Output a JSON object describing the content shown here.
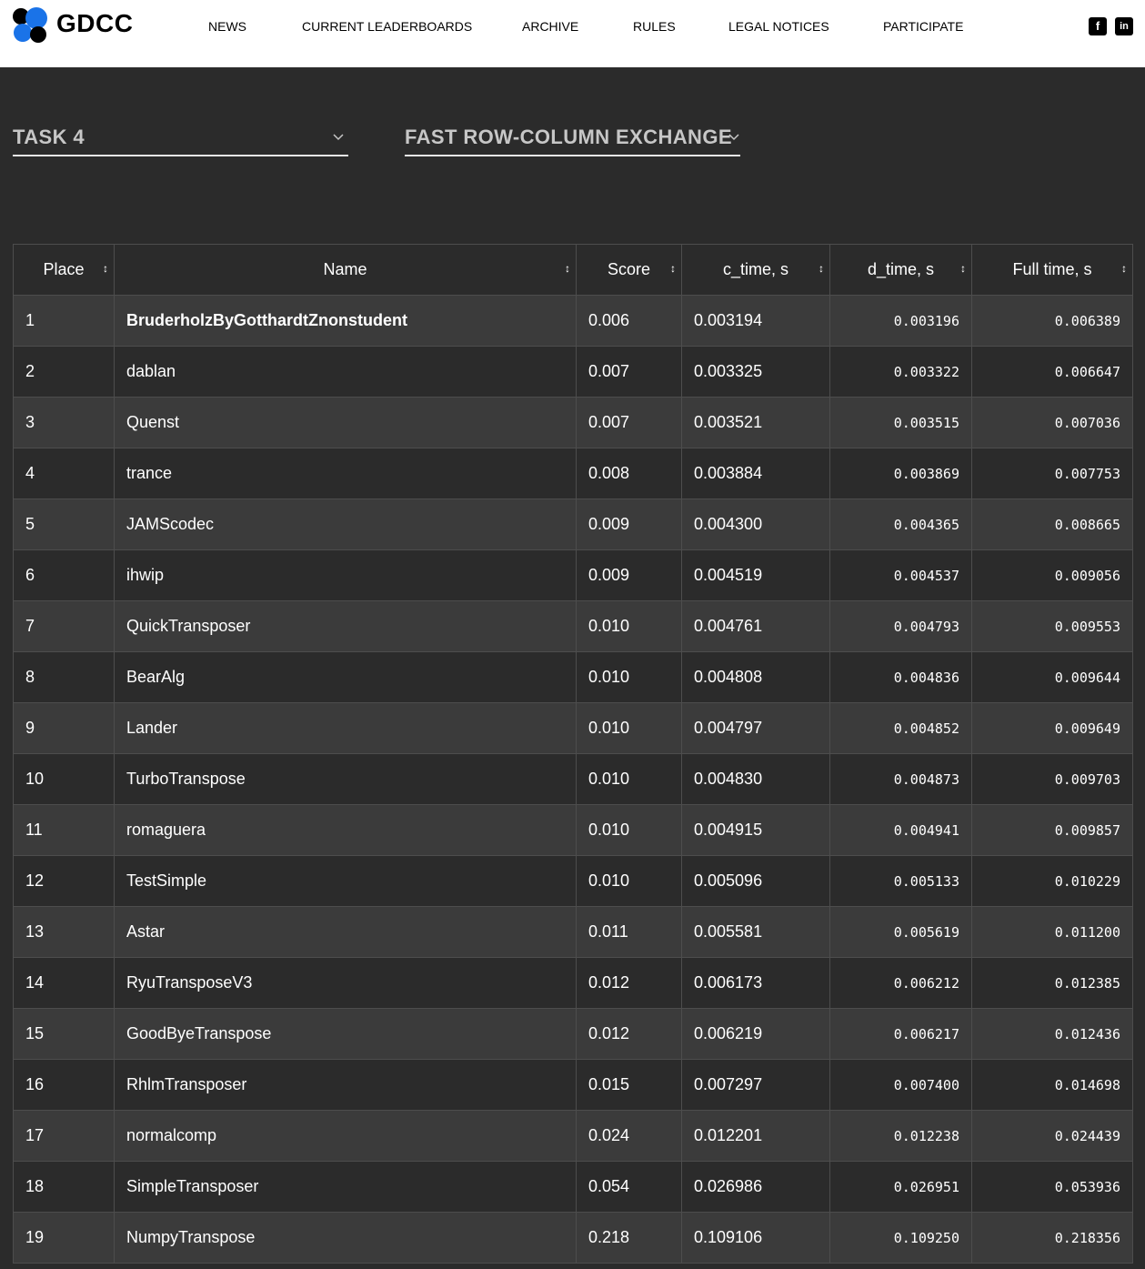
{
  "header": {
    "brand": "GDCC",
    "nav": [
      "NEWS",
      "CURRENT LEADERBOARDS",
      "ARCHIVE",
      "RULES",
      "LEGAL NOTICES",
      "PARTICIPATE"
    ],
    "social": [
      {
        "icon": "facebook-icon",
        "glyph": "f"
      },
      {
        "icon": "linkedin-icon",
        "glyph": "in"
      }
    ],
    "logo_colors": [
      "#1a73e8",
      "#000000"
    ]
  },
  "filters": {
    "task": "TASK 4",
    "challenge": "FAST ROW-COLUMN EXCHANGE"
  },
  "leaderboard": {
    "columns": [
      "Place",
      "Name",
      "Score",
      "c_time, s",
      "d_time, s",
      "Full time, s"
    ],
    "rows": [
      [
        "1",
        "BruderholzByGotthardtZnonstudent",
        "0.006",
        "0.003194",
        "0.003196",
        "0.006389"
      ],
      [
        "2",
        "dablan",
        "0.007",
        "0.003325",
        "0.003322",
        "0.006647"
      ],
      [
        "3",
        "Quenst",
        "0.007",
        "0.003521",
        "0.003515",
        "0.007036"
      ],
      [
        "4",
        "trance",
        "0.008",
        "0.003884",
        "0.003869",
        "0.007753"
      ],
      [
        "5",
        "JAMScodec",
        "0.009",
        "0.004300",
        "0.004365",
        "0.008665"
      ],
      [
        "6",
        "ihwip",
        "0.009",
        "0.004519",
        "0.004537",
        "0.009056"
      ],
      [
        "7",
        "QuickTransposer",
        "0.010",
        "0.004761",
        "0.004793",
        "0.009553"
      ],
      [
        "8",
        "BearAlg",
        "0.010",
        "0.004808",
        "0.004836",
        "0.009644"
      ],
      [
        "9",
        "Lander",
        "0.010",
        "0.004797",
        "0.004852",
        "0.009649"
      ],
      [
        "10",
        "TurboTranspose",
        "0.010",
        "0.004830",
        "0.004873",
        "0.009703"
      ],
      [
        "11",
        "romaguera",
        "0.010",
        "0.004915",
        "0.004941",
        "0.009857"
      ],
      [
        "12",
        "TestSimple",
        "0.010",
        "0.005096",
        "0.005133",
        "0.010229"
      ],
      [
        "13",
        "Astar",
        "0.011",
        "0.005581",
        "0.005619",
        "0.011200"
      ],
      [
        "14",
        "RyuTransposeV3",
        "0.012",
        "0.006173",
        "0.006212",
        "0.012385"
      ],
      [
        "15",
        "GoodByeTranspose",
        "0.012",
        "0.006219",
        "0.006217",
        "0.012436"
      ],
      [
        "16",
        "RhlmTransposer",
        "0.015",
        "0.007297",
        "0.007400",
        "0.014698"
      ],
      [
        "17",
        "normalcomp",
        "0.024",
        "0.012201",
        "0.012238",
        "0.024439"
      ],
      [
        "18",
        "SimpleTransposer",
        "0.054",
        "0.026986",
        "0.026951",
        "0.053936"
      ],
      [
        "19",
        "NumpyTranspose",
        "0.218",
        "0.109106",
        "0.109250",
        "0.218356"
      ]
    ]
  },
  "colors": {
    "background": "#2b2b2b",
    "row_alt": "#3b3b3b",
    "border": "#4d4d4d"
  }
}
